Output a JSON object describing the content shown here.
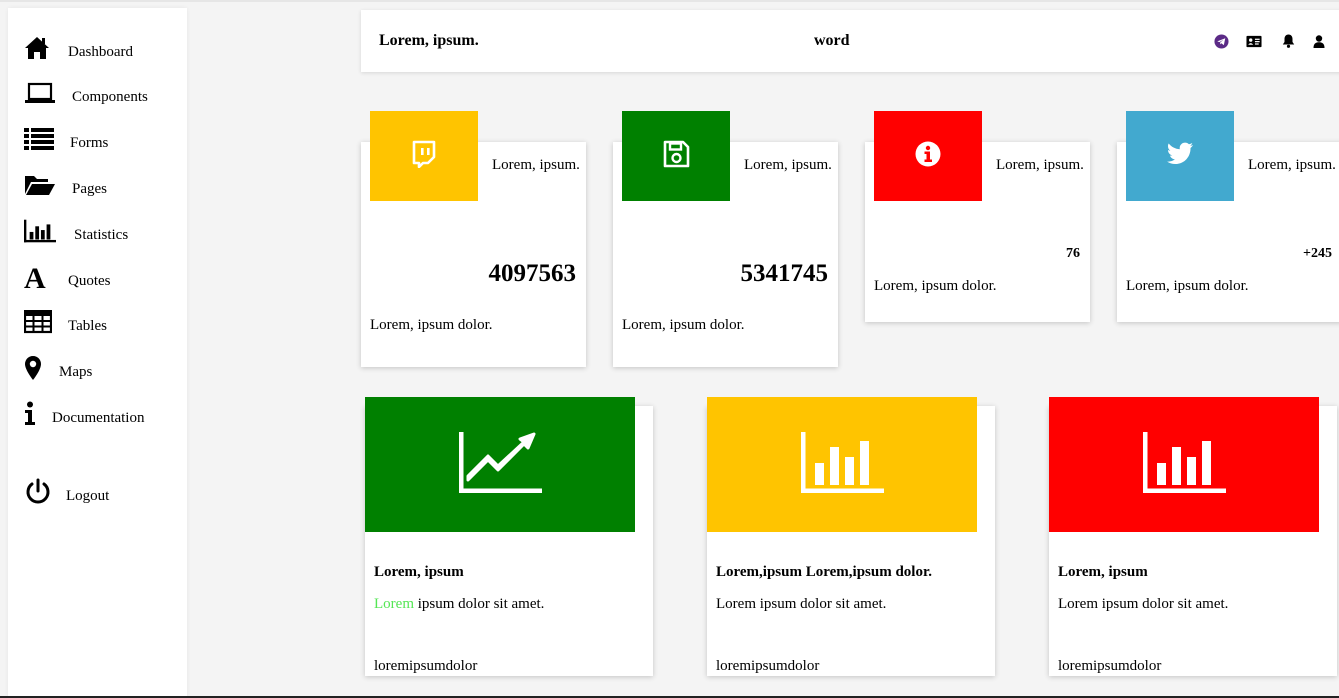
{
  "sidebar": {
    "items": [
      {
        "label": "Dashboard",
        "icon": "home-icon"
      },
      {
        "label": "Components",
        "icon": "laptop-icon"
      },
      {
        "label": "Forms",
        "icon": "list-icon"
      },
      {
        "label": "Pages",
        "icon": "folder-open-icon"
      },
      {
        "label": "Statistics",
        "icon": "bar-chart-icon"
      },
      {
        "label": "Quotes",
        "icon": "font-icon"
      },
      {
        "label": "Tables",
        "icon": "table-icon"
      },
      {
        "label": "Maps",
        "icon": "map-marker-icon"
      },
      {
        "label": "Documentation",
        "icon": "info-icon"
      }
    ],
    "logout_label": "Logout"
  },
  "header": {
    "brand": "Lorem, ipsum.",
    "center_word": "word",
    "icons": [
      "telegram-icon",
      "id-card-icon",
      "bell-icon",
      "user-icon"
    ]
  },
  "stat_cards": [
    {
      "title": "Lorem, ipsum.",
      "value": "4097563",
      "footer": "Lorem, ipsum dolor.",
      "color": "#ffc400",
      "icon": "twitch-icon"
    },
    {
      "title": "Lorem, ipsum.",
      "value": "5341745",
      "footer": "Lorem, ipsum dolor.",
      "color": "#008000",
      "icon": "floppy-disk-icon"
    },
    {
      "title": "Lorem, ipsum.",
      "value": "76",
      "footer": "Lorem, ipsum dolor.",
      "color": "#ff0000",
      "icon": "info-circle-icon"
    },
    {
      "title": "Lorem, ipsum.",
      "value": "+245",
      "footer": "Lorem, ipsum dolor.",
      "color": "#42a9cf",
      "icon": "twitter-icon"
    }
  ],
  "big_cards": [
    {
      "title": "Lorem, ipsum",
      "text_highlight": "Lorem",
      "text": " ipsum dolor sit amet.",
      "footer": "loremipsumdolor",
      "color": "#008000",
      "icon": "chart-line-icon"
    },
    {
      "title": "Lorem,ipsum Lorem,ipsum dolor.",
      "text": "Lorem ipsum dolor sit amet.",
      "footer": "loremipsumdolor",
      "color": "#ffc400",
      "icon": "bar-chart-icon"
    },
    {
      "title": "Lorem, ipsum",
      "text": "Lorem ipsum dolor sit amet.",
      "footer": "loremipsumdolor",
      "color": "#ff0000",
      "icon": "bar-chart-icon"
    }
  ],
  "colors": {
    "highlight_text": "#55e655"
  }
}
